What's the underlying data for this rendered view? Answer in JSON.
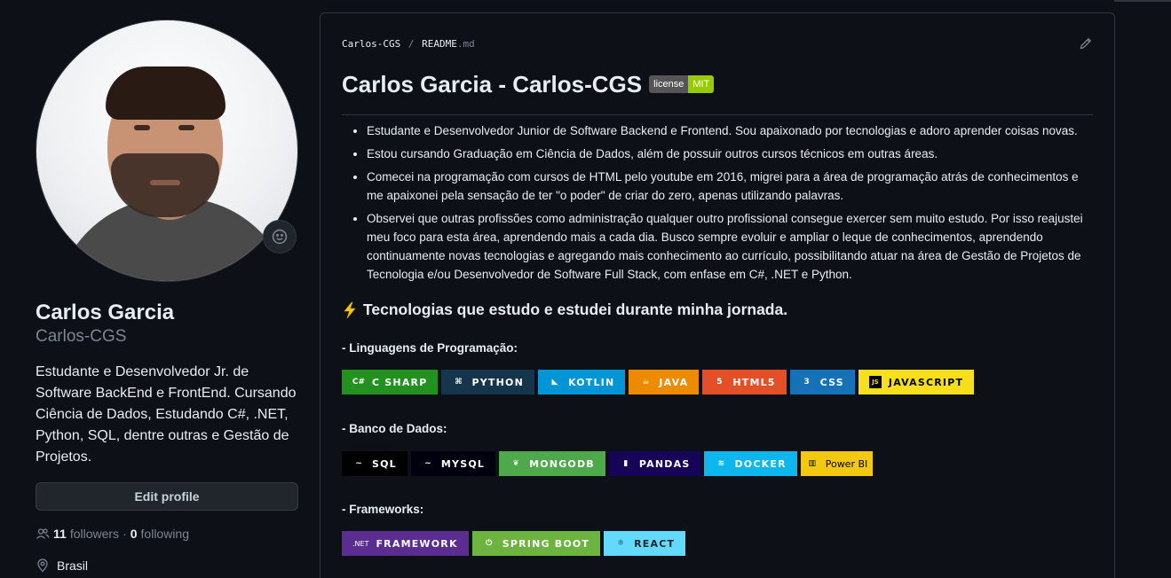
{
  "profile": {
    "name": "Carlos Garcia",
    "username": "Carlos-CGS",
    "bio": "Estudante e Desenvolvedor Jr. de Software BackEnd e FrontEnd. Cursando Ciência de Dados, Estudando C#, .NET, Python, SQL, dentre outras e Gestão de Projetos.",
    "edit_label": "Edit profile",
    "followers_count": "11",
    "followers_label": "followers",
    "separator": "·",
    "following_count": "0",
    "following_label": "following",
    "location": "Brasil"
  },
  "readme": {
    "crumb_repo": "Carlos-CGS",
    "crumb_sep": "/",
    "crumb_file": "README",
    "crumb_ext": ".md",
    "title": "Carlos Garcia - Carlos-CGS",
    "license_left": "license",
    "license_right": "MIT",
    "bullets": [
      "Estudante e Desenvolvedor Junior de Software Backend e Frontend. Sou apaixonado por tecnologias e adoro aprender coisas novas.",
      "Estou cursando Graduação em Ciência de Dados, além de possuir outros cursos técnicos em outras áreas.",
      "Comecei na programação com cursos de HTML pelo youtube em 2016, migrei para a área de programação atrás de conhecimentos e me apaixonei pela sensação de ter \"o poder\" de criar do zero, apenas utilizando palavras.",
      "Observei que outras profissões como administração qualquer outro profissional consegue exercer sem muito estudo. Por isso reajustei meu foco para esta área, aprendendo mais a cada dia. Busco sempre evoluir e ampliar o leque de conhecimentos, aprendendo continuamente novas tecnologias e agregando mais conhecimento ao currículo, possibilitando atuar na área de Gestão de Projetos de Tecnologia e/ou Desenvolvedor de Software Full Stack, com enfase em C#, .NET e Python."
    ],
    "tech_heading": "Tecnologias que estudo e estudei durante minha jornada.",
    "sections": {
      "languages": "- Linguagens de Programação:",
      "databases": "- Banco de Dados:",
      "frameworks": "- Frameworks:"
    },
    "languages": [
      {
        "label": "C SHARP",
        "color": "#239120",
        "icon": "c#"
      },
      {
        "label": "PYTHON",
        "color": "#14354c",
        "icon": "python"
      },
      {
        "label": "KOTLIN",
        "color": "#0095d5",
        "icon": "kotlin"
      },
      {
        "label": "JAVA",
        "color": "#ed8b00",
        "icon": "java"
      },
      {
        "label": "HTML5",
        "color": "#e34f26",
        "icon": "html5"
      },
      {
        "label": "CSS",
        "color": "#1572b6",
        "icon": "css3"
      },
      {
        "label": "JAVASCRIPT",
        "color": "#f7df1e",
        "icon": "js"
      }
    ],
    "databases": [
      {
        "label": "SQL",
        "color": "#000000",
        "icon": "mysql"
      },
      {
        "label": "MYSQL",
        "color": "#00000f",
        "icon": "mysql"
      },
      {
        "label": "MONGODB",
        "color": "#4ea94b",
        "icon": "leaf"
      },
      {
        "label": "PANDAS",
        "color": "#150458",
        "icon": "pandas"
      },
      {
        "label": "DOCKER",
        "color": "#0db7ed",
        "icon": "docker"
      },
      {
        "label": "Power BI",
        "color": "#f2c811",
        "icon": "powerbi"
      }
    ],
    "frameworks": [
      {
        "label": "FRAMEWORK",
        "color": "#5c2d91",
        "icon": ".NET"
      },
      {
        "label": "SPRING BOOT",
        "color": "#6db33f",
        "icon": "spring"
      },
      {
        "label": "REACT",
        "color": "#61dafb",
        "icon": "react"
      }
    ]
  }
}
